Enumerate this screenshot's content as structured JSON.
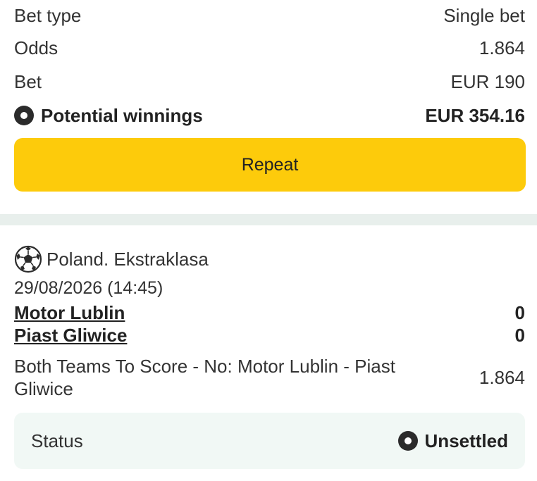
{
  "summary": {
    "bet_type_label": "Bet type",
    "bet_type_value": "Single bet",
    "odds_label": "Odds",
    "odds_value": "1.864",
    "bet_label": "Bet",
    "bet_value": "EUR 190",
    "winnings_label": "Potential winnings",
    "winnings_value": "EUR 354.16",
    "winnings_icon": "radio-dot-icon"
  },
  "repeat_button": {
    "label": "Repeat",
    "color": "#fdcb0b"
  },
  "event": {
    "sport_icon": "soccer-ball-icon",
    "league": "Poland. Ekstraklasa",
    "datetime": "29/08/2026 (14:45)",
    "teams": [
      {
        "name": "Motor Lublin",
        "score": "0"
      },
      {
        "name": "Piast Gliwice",
        "score": "0"
      }
    ],
    "market": "Both Teams To Score - No: Motor Lublin - Piast Gliwice",
    "market_odds": "1.864"
  },
  "status": {
    "label": "Status",
    "value": "Unsettled",
    "icon": "radio-dot-icon"
  },
  "colors": {
    "divider": "#e8efec",
    "status_bg": "#f1f8f5"
  }
}
